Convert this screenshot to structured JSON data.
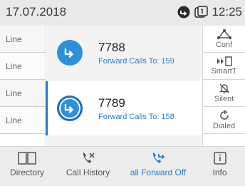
{
  "status": {
    "date": "17.07.2018",
    "time": "12:25"
  },
  "line_keys": [
    "Line",
    "Line",
    "Line",
    "Line"
  ],
  "calls": [
    {
      "number": "7788",
      "forward": "Forward Calls To: 159"
    },
    {
      "number": "7789",
      "forward": "Forward Calls To: 158"
    }
  ],
  "softkeys": [
    {
      "label": "Conf",
      "icon": "conference-icon"
    },
    {
      "label": "SmartT",
      "icon": "smart-transfer-icon"
    },
    {
      "label": "Silent",
      "icon": "silent-bell-icon"
    },
    {
      "label": "Dialed",
      "icon": "redial-icon"
    }
  ],
  "tabs": [
    {
      "label": "Directory",
      "icon": "book-icon"
    },
    {
      "label": "Call History",
      "icon": "call-history-icon"
    },
    {
      "label": "all Forward Off",
      "icon": "forward-icon"
    },
    {
      "label": "Info",
      "icon": "info-icon"
    }
  ],
  "colors": {
    "accent": "#2a7fcc",
    "call_icon": "#2e90d8"
  }
}
